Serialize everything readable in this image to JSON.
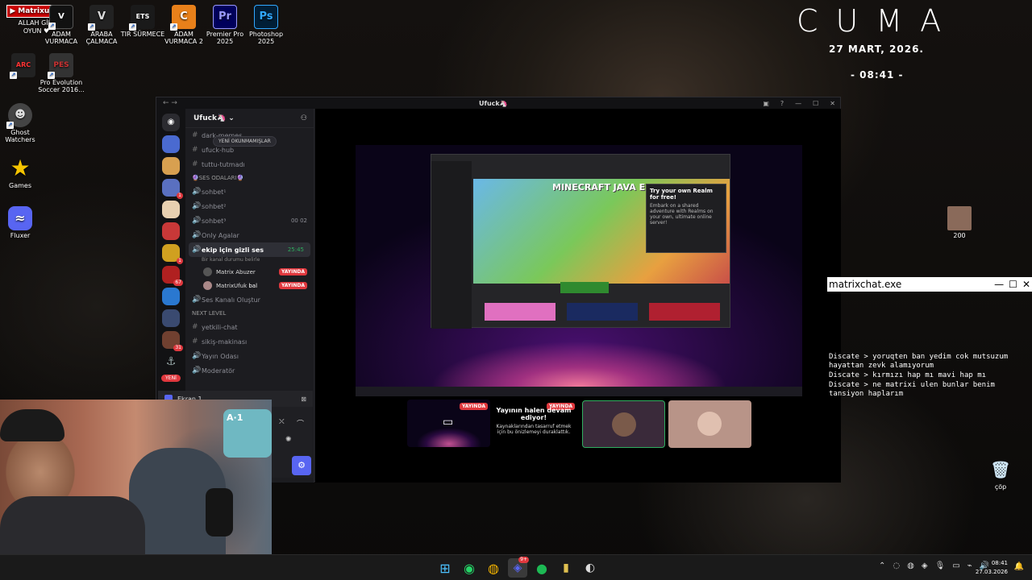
{
  "desktop": {
    "icons": [
      {
        "label": "ALLAH GİBİ OYUN ♥",
        "top_label": "Matrixufuk"
      },
      {
        "label": "ADAM VURMACA"
      },
      {
        "label": "ARABA ÇALMACA"
      },
      {
        "label": "TIR SÜRMECE"
      },
      {
        "label": "ADAM VURMACA 2"
      },
      {
        "label": "Premier Pro 2025",
        "glyph": "Pr"
      },
      {
        "label": "Photoshop 2025",
        "glyph": "Ps"
      },
      {
        "label": "Pro Evolution Soccer 2016..."
      },
      {
        "label": "Ghost Watchers"
      },
      {
        "label": "Games"
      },
      {
        "label": "Fluxer"
      },
      {
        "label": "200"
      },
      {
        "label": "çöp"
      }
    ]
  },
  "clock_widget": {
    "day": "CUMA",
    "date": "27 MART, 2026.",
    "time": "- 08:41 -"
  },
  "discord": {
    "window_title": "Ufuck🦄",
    "server_name": "Ufuck🦄",
    "unread_pill": "YENİ OKUNMAMIŞLAR",
    "new_label": "YENİ",
    "channels": [
      {
        "sym": "#",
        "name": "dark-memes"
      },
      {
        "sym": "#",
        "name": "ufuck-hub"
      },
      {
        "sym": "#",
        "name": "tuttu-tutmadı"
      },
      {
        "sym": "",
        "name": "🔮SES ODALARI🔮",
        "cat": true
      },
      {
        "sym": "🔊",
        "name": "sohbet¹"
      },
      {
        "sym": "🔊",
        "name": "sohbet²"
      },
      {
        "sym": "🔊",
        "name": "sohbet³",
        "right": "00  02"
      },
      {
        "sym": "🔊",
        "name": "Only Agalar"
      }
    ],
    "active_channel": {
      "name": "ekip için gizli ses",
      "time": "25:45",
      "sub": "Bir kanal durumu belirle"
    },
    "voice_users": [
      {
        "name": "Matrix Abuzer",
        "badge": "YAYINDA"
      },
      {
        "name": "MatrixUfuk",
        "extra": "bal",
        "badge": "YAYINDA"
      }
    ],
    "channels_after": [
      {
        "sym": "🔊",
        "name": "Ses Kanalı Oluştur"
      },
      {
        "sym": "",
        "name": "next level",
        "cat": true
      },
      {
        "sym": "#",
        "name": "yetkili-chat"
      },
      {
        "sym": "#",
        "name": "sikiş-makinası"
      },
      {
        "sym": "🔊",
        "name": "Yayın Odası"
      },
      {
        "sym": "🔊",
        "name": "Moderatör"
      }
    ],
    "screen_share_label": "Ekran 1",
    "guild_badges": [
      "",
      "",
      "1",
      "",
      "",
      "1",
      "67",
      "",
      "",
      "31"
    ],
    "stream": {
      "paused_title": "Yayının halen devam ediyor!",
      "paused_sub": "Kaynaklarından tasarruf etmek için bu önizlemeyi duraklattık.",
      "live_badge": "YAYINDA"
    },
    "minecraft": {
      "title": "MINECRAFT JAVA EDITION",
      "popup_title": "Try your own Realm for free!",
      "popup_text": "Embark on a shared adventure with Realms on your own, ultimate online server!"
    }
  },
  "matrixchat": {
    "title": "matrixchat.exe",
    "messages": [
      "Discate > yoruqten ban yedim cok mutsuzum hayattan zevk alamıyorum",
      "Discate > kırmızı hap mı mavi hap mı",
      "Discate > ne matrixi ulen bunlar benim tansiyon haplarım"
    ]
  },
  "taskbar": {
    "time": "08:41",
    "date": "27.03.2026",
    "discord_badge": "9+"
  }
}
